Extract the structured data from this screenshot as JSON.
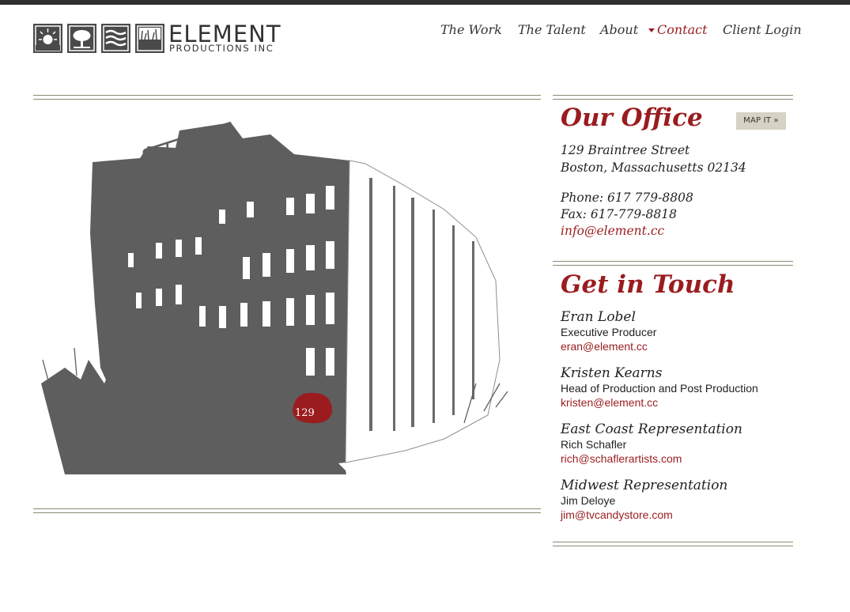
{
  "brand": {
    "name": "ELEMENT",
    "tagline": "PRODUCTIONS INC"
  },
  "nav": {
    "items": [
      "The Work",
      "The Talent",
      "About",
      "Contact",
      "Client Login"
    ],
    "active": "Contact"
  },
  "illustration": {
    "badge_text": "129"
  },
  "office": {
    "heading": "Our Office",
    "map_button": "MAP IT »",
    "address_line1": "129 Braintree Street",
    "address_line2": "Boston, Massachusetts 02134",
    "phone": "Phone: 617 779-8808",
    "fax": "Fax: 617-779-8818",
    "email": "info@element.cc"
  },
  "touch": {
    "heading": "Get in Touch",
    "contacts": [
      {
        "name": "Eran Lobel",
        "role": "Executive Producer",
        "email": "eran@element.cc"
      },
      {
        "name": "Kristen Kearns",
        "role": "Head of Production and Post Production",
        "email": "kristen@element.cc"
      },
      {
        "name": "East Coast Representation",
        "role": "Rich Schafler",
        "email": "rich@schaflerartists.com"
      },
      {
        "name": "Midwest Representation",
        "role": "Jim Deloye",
        "email": "jim@tvcandystore.com"
      }
    ]
  },
  "colors": {
    "accent": "#9a1c1f",
    "text": "#222222",
    "rule": "#8a8a70",
    "building": "#5e5e5e",
    "button_bg": "#d6d2c4"
  }
}
